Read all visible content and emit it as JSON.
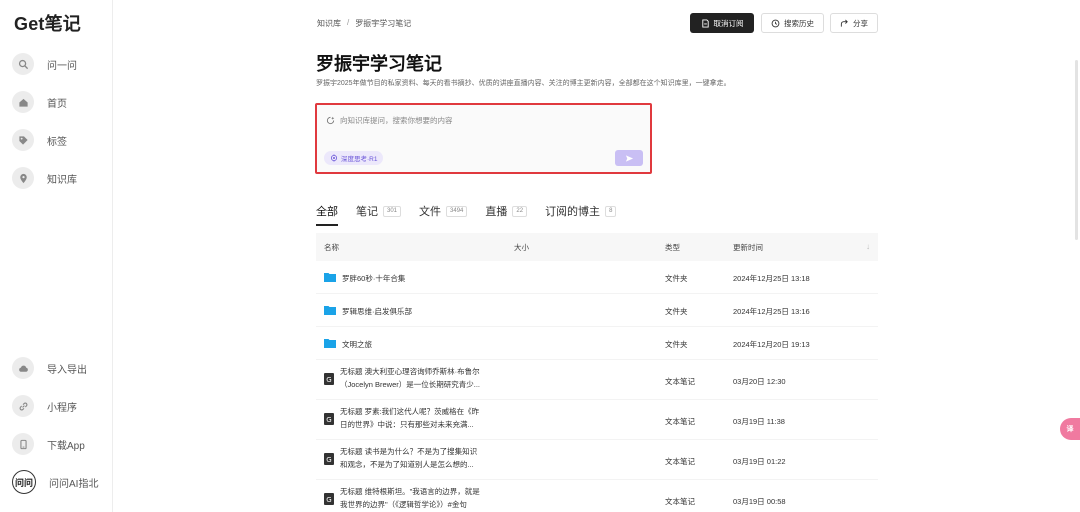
{
  "sidebar": {
    "logo": "Get笔记",
    "top_items": [
      {
        "label": "问一问",
        "icon": "search-icon"
      },
      {
        "label": "首页",
        "icon": "home-icon"
      },
      {
        "label": "标签",
        "icon": "tag-icon"
      },
      {
        "label": "知识库",
        "icon": "location-pin-icon"
      }
    ],
    "bottom_items": [
      {
        "label": "导入导出",
        "icon": "cloud-icon"
      },
      {
        "label": "小程序",
        "icon": "link-icon"
      },
      {
        "label": "下载App",
        "icon": "phone-icon"
      },
      {
        "label": "问问AI指北",
        "icon": "wenwen-badge-icon",
        "badge": "问问"
      }
    ]
  },
  "header": {
    "breadcrumb": [
      "知识库",
      "罗振宇学习笔记"
    ],
    "breadcrumb_sep": "/",
    "buttons": {
      "unsubscribe": "取消订阅",
      "search_history": "搜索历史",
      "share": "分享"
    }
  },
  "main": {
    "title": "罗振宇学习笔记",
    "description": "罗振宇2025年做节目的私家资料、每天的看书摘抄、优质的讲座直播内容、关注的博主更新内容，全部都在这个知识库里，一键拿走。"
  },
  "ask": {
    "placeholder": "向知识库提问，搜索你想要的内容",
    "mode_chip": "深度思考·R1"
  },
  "tabs": [
    {
      "label": "全部",
      "count": "",
      "active": true
    },
    {
      "label": "笔记",
      "count": "301"
    },
    {
      "label": "文件",
      "count": "3494"
    },
    {
      "label": "直播",
      "count": "22"
    },
    {
      "label": "订阅的博主",
      "count": "8"
    }
  ],
  "table": {
    "columns": [
      "名称",
      "大小",
      "类型",
      "更新时间"
    ],
    "sort_arrow": "↓",
    "rows": [
      {
        "icon": "folder-icon",
        "name_line1": "罗胖60秒·十年合集",
        "name_line2": "",
        "type": "文件夹",
        "time": "2024年12月25日 13:18"
      },
      {
        "icon": "folder-icon",
        "name_line1": "罗辑思维·启发俱乐部",
        "name_line2": "",
        "type": "文件夹",
        "time": "2024年12月25日 13:16"
      },
      {
        "icon": "folder-icon",
        "name_line1": "文明之旅",
        "name_line2": "",
        "type": "文件夹",
        "time": "2024年12月20日 19:13"
      },
      {
        "icon": "doc-icon",
        "name_line1": "无标题 澳大利亚心理咨询师乔斯林·布鲁尔",
        "name_line2": "（Jocelyn Brewer）是一位长期研究青少...",
        "type": "文本笔记",
        "time": "03月20日 12:30"
      },
      {
        "icon": "doc-icon",
        "name_line1": "无标题 罗素:我们这代人呢？茨威格在《昨",
        "name_line2": "日的世界》中说：只有那些对未来充满...",
        "type": "文本笔记",
        "time": "03月19日 11:38"
      },
      {
        "icon": "doc-icon",
        "name_line1": "无标题 读书是为什么？不是为了搜集知识",
        "name_line2": "和观念，不是为了知道别人是怎么想的...",
        "type": "文本笔记",
        "time": "03月19日 01:22"
      },
      {
        "icon": "doc-icon",
        "name_line1": "无标题 维特根斯坦。\"我语言的边界，就是",
        "name_line2": "我世界的边界\"（《逻辑哲学论》）#金句",
        "type": "文本笔记",
        "time": "03月19日 00:58"
      }
    ]
  },
  "floating_button": "译",
  "colors": {
    "accent_purple": "#6a55d8",
    "highlight_red": "#e0393e",
    "folder_blue": "#1aa3e8",
    "dark_button": "#222222"
  }
}
